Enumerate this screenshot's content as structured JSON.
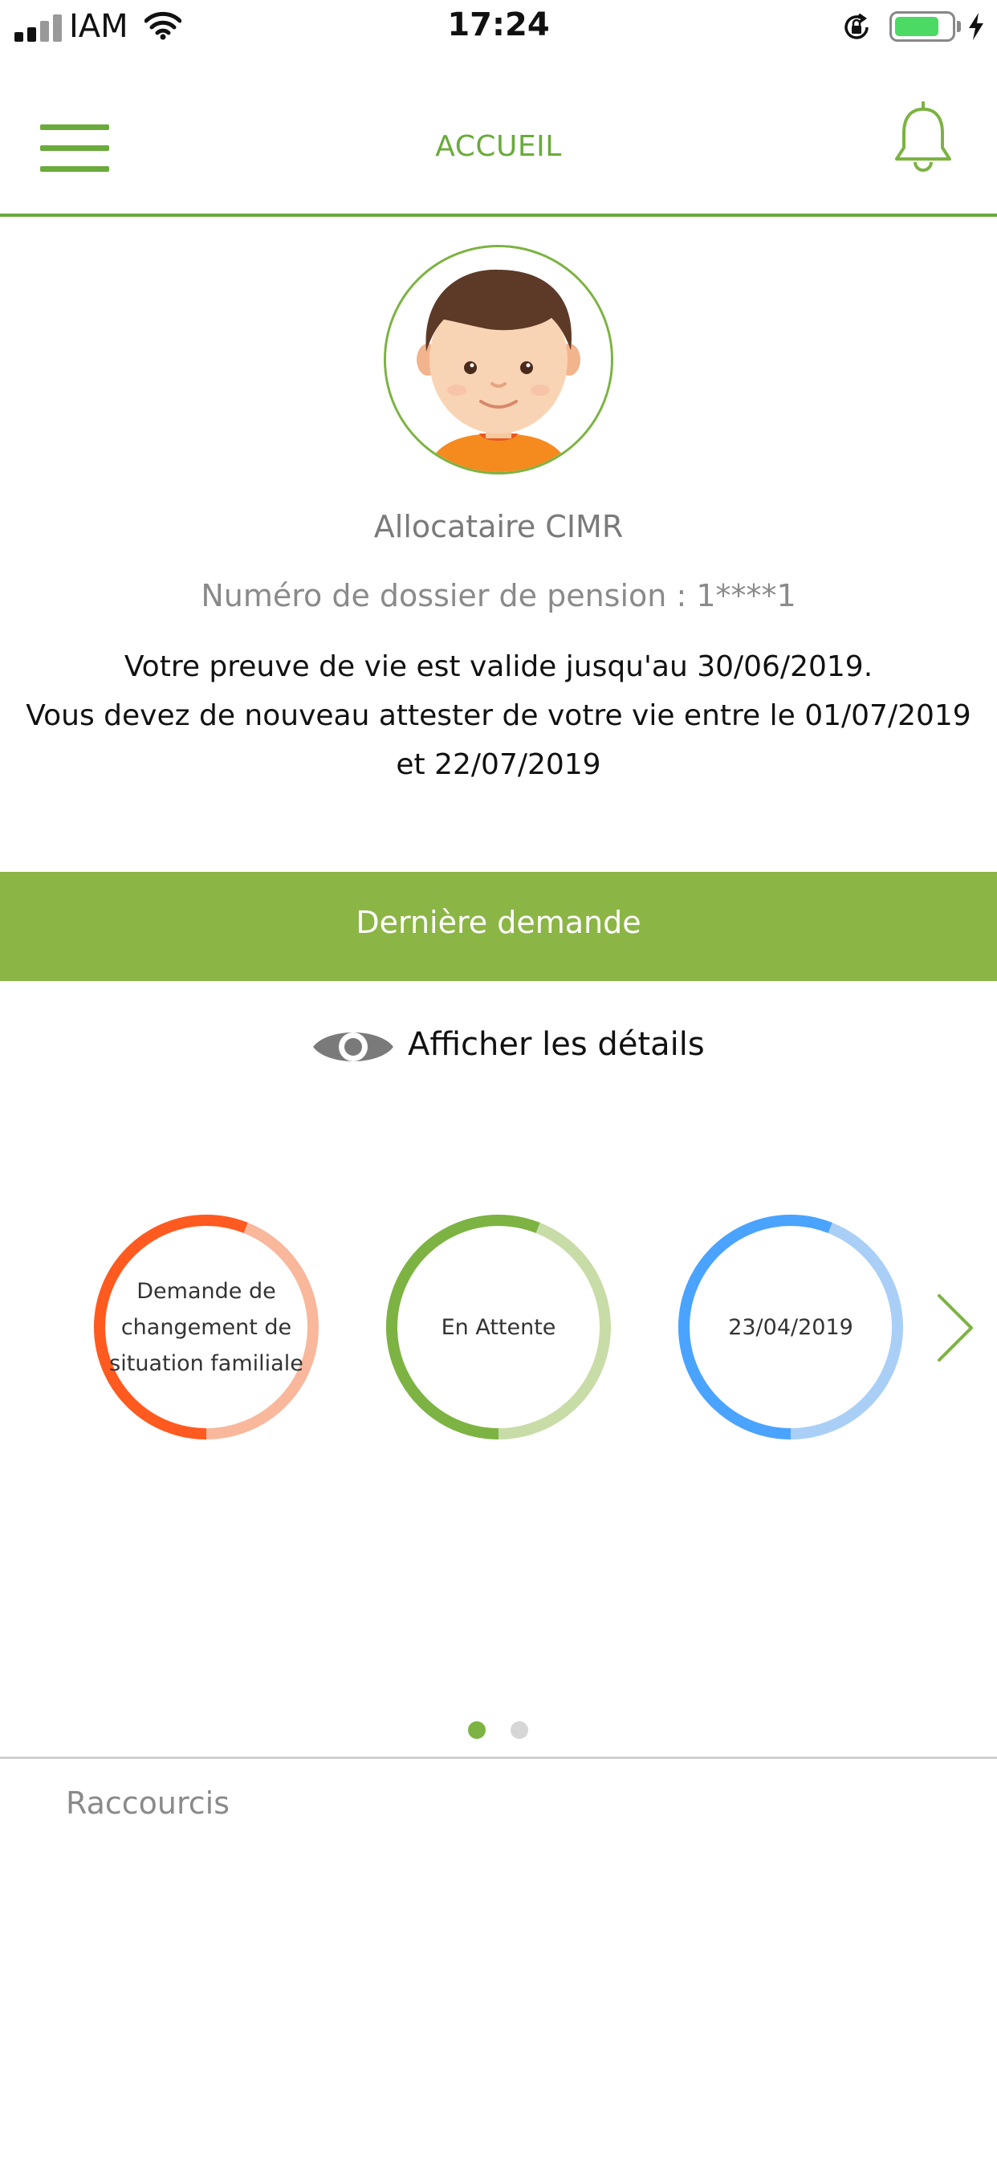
{
  "status_bar": {
    "carrier": "IAM",
    "time": "17:24",
    "battery_level": 0.8,
    "battery_color": "#4cd964"
  },
  "header": {
    "title": "ACCUEIL",
    "menu_icon": "hamburger-menu-icon",
    "notification_icon": "bell-icon",
    "accent_color": "#6aab3b"
  },
  "profile": {
    "avatar_icon": "user-avatar",
    "user_type": "Allocataire CIMR",
    "file_number": "Numéro de dossier de pension : 1****1",
    "validity_lines": [
      "Votre preuve de vie est valide jusqu'au 30/06/2019.",
      "Vous devez de nouveau attester de votre vie entre le 01/07/2019",
      "et 22/07/2019"
    ]
  },
  "last_request": {
    "title": "Dernière demande",
    "band_color": "#8bb545",
    "details_label": "Afficher les détails",
    "details_icon": "eye-icon",
    "next_icon": "chevron-right-icon",
    "cards": [
      {
        "label_lines": [
          "Demande de",
          "changement de",
          "situation familiale"
        ],
        "color": "#ff5a1f",
        "light_color": "#f9b79b",
        "progress": 0.5
      },
      {
        "label_lines": [
          "En Attente"
        ],
        "color": "#7cb342",
        "light_color": "#c8dca8",
        "progress": 0.5
      },
      {
        "label_lines": [
          "23/04/2019"
        ],
        "color": "#4aa3ff",
        "light_color": "#a9cff7",
        "progress": 0.5
      }
    ],
    "pagination": {
      "pages": 2,
      "current": 1
    }
  },
  "shortcuts": {
    "title": "Raccourcis"
  }
}
